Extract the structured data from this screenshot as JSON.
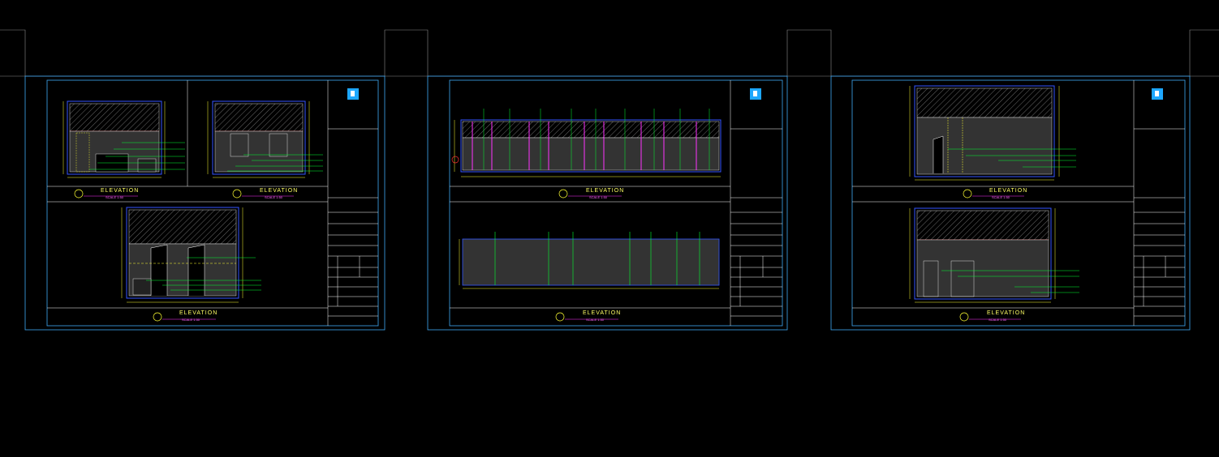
{
  "sheets": [
    {
      "elevations": [
        {
          "label": "ELEVATION",
          "scale": "SCALE 1:50"
        },
        {
          "label": "ELEVATION",
          "scale": "SCALE 1:50"
        },
        {
          "label": "ELEVATION",
          "scale": "SCALE 1:50"
        }
      ]
    },
    {
      "elevations": [
        {
          "label": "ELEVATION",
          "scale": "SCALE 1:50"
        },
        {
          "label": "ELEVATION",
          "scale": "SCALE 1:50"
        }
      ]
    },
    {
      "elevations": [
        {
          "label": "ELEVATION",
          "scale": "SCALE 1:50"
        },
        {
          "label": "ELEVATION",
          "scale": "SCALE 1:50"
        }
      ]
    }
  ],
  "colors": {
    "background": "#000000",
    "frame": "#3fa9f5",
    "outline": "#ffffff",
    "dimension": "#ffff33",
    "leader": "#00ff33",
    "magenta": "#ff33ff",
    "red": "#ff3333",
    "hatch": "#666666",
    "wall": "#333333",
    "logo": "#1ea7ff"
  }
}
